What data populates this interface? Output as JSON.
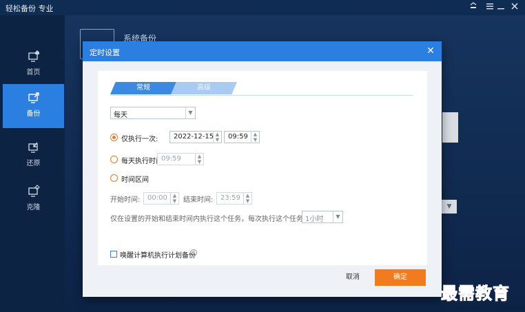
{
  "app": {
    "title": "轻松备份 专业",
    "window_controls": [
      "minimize-to-tray-icon",
      "menu-icon",
      "minimize-icon",
      "close-icon"
    ]
  },
  "sidebar": {
    "items": [
      {
        "label": "首页",
        "icon": "home-monitor-icon",
        "active": false
      },
      {
        "label": "备份",
        "icon": "backup-monitor-icon",
        "active": true
      },
      {
        "label": "还原",
        "icon": "restore-monitor-icon",
        "active": false
      },
      {
        "label": "克隆",
        "icon": "clone-monitor-icon",
        "active": false
      }
    ]
  },
  "background": {
    "section_title": "系统备份"
  },
  "dialog": {
    "title": "定时设置",
    "tabs": [
      {
        "label": "常规",
        "active": true
      },
      {
        "label": "高级",
        "active": false
      }
    ],
    "frequency": {
      "value": "每天"
    },
    "run_once": {
      "label": "仅执行一次:",
      "date": "2022-12-15",
      "time": "09:59",
      "selected": true
    },
    "daily_time": {
      "label": "每天执行时间:",
      "time": "09:59",
      "selected": false
    },
    "time_range": {
      "label": "时间区间",
      "selected": false
    },
    "start_label": "开始时间:",
    "start_time": "00:00",
    "end_label": "结束时间:",
    "end_time": "23:59",
    "interval_text": "仅在设置的开始和结束时间内执行这个任务，每次执行这个任务间隔:",
    "interval_value": "1小时",
    "wake_label": "唤醒计算机执行计划备份",
    "cancel_label": "取消",
    "ok_label": "确定"
  },
  "watermark": "最需教育",
  "colors": {
    "accent_blue": "#2b7fe0",
    "ok_orange": "#f27a1f",
    "app_bg": "#0d2344"
  }
}
